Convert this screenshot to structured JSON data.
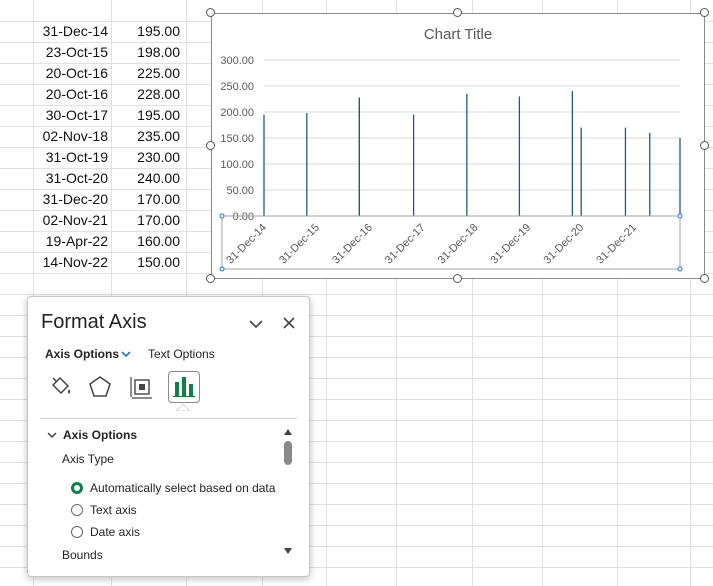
{
  "sheet": {
    "rows": [
      {
        "date": "31-Dec-14",
        "value": "195.00"
      },
      {
        "date": "23-Oct-15",
        "value": "198.00"
      },
      {
        "date": "20-Oct-16",
        "value": "225.00"
      },
      {
        "date": "20-Oct-16",
        "value": "228.00"
      },
      {
        "date": "30-Oct-17",
        "value": "195.00"
      },
      {
        "date": "02-Nov-18",
        "value": "235.00"
      },
      {
        "date": "31-Oct-19",
        "value": "230.00"
      },
      {
        "date": "31-Oct-20",
        "value": "240.00"
      },
      {
        "date": "31-Dec-20",
        "value": "170.00"
      },
      {
        "date": "02-Nov-21",
        "value": "170.00"
      },
      {
        "date": "19-Apr-22",
        "value": "160.00"
      },
      {
        "date": "14-Nov-22",
        "value": "150.00"
      }
    ]
  },
  "chart_data": {
    "type": "bar",
    "title": "Chart Title",
    "x_axis_type": "date",
    "x_range": [
      "2014-12-31",
      "2022-11-14"
    ],
    "ylim": [
      0,
      300
    ],
    "y_ticks": [
      "0.00",
      "50.00",
      "100.00",
      "150.00",
      "200.00",
      "250.00",
      "300.00"
    ],
    "x_ticks": [
      {
        "label": "31-Dec-14",
        "date": "2014-12-31"
      },
      {
        "label": "31-Dec-15",
        "date": "2015-12-31"
      },
      {
        "label": "31-Dec-16",
        "date": "2016-12-31"
      },
      {
        "label": "31-Dec-17",
        "date": "2017-12-31"
      },
      {
        "label": "31-Dec-18",
        "date": "2018-12-31"
      },
      {
        "label": "31-Dec-19",
        "date": "2019-12-31"
      },
      {
        "label": "31-Dec-20",
        "date": "2020-12-31"
      },
      {
        "label": "31-Dec-21",
        "date": "2021-12-31"
      }
    ],
    "points": [
      {
        "x": "2014-12-31",
        "y": 195
      },
      {
        "x": "2015-10-23",
        "y": 198
      },
      {
        "x": "2016-10-20",
        "y": 225
      },
      {
        "x": "2016-10-20",
        "y": 228
      },
      {
        "x": "2017-10-30",
        "y": 195
      },
      {
        "x": "2018-11-02",
        "y": 235
      },
      {
        "x": "2019-10-31",
        "y": 230
      },
      {
        "x": "2020-10-31",
        "y": 240
      },
      {
        "x": "2020-12-31",
        "y": 170
      },
      {
        "x": "2021-11-02",
        "y": 170
      },
      {
        "x": "2022-04-19",
        "y": 160
      },
      {
        "x": "2022-11-14",
        "y": 150
      }
    ],
    "grid": true,
    "colors": {
      "bar": "#1f5c7a",
      "grid": "#d9d9d9",
      "text": "#595959",
      "title": "#595959"
    }
  },
  "pane": {
    "title": "Format Axis",
    "tabs": {
      "axis_options": "Axis Options",
      "text_options": "Text Options"
    },
    "section_title": "Axis Options",
    "axis_type_label": "Axis Type",
    "radios": [
      {
        "label": "Automatically select based on data",
        "selected": true
      },
      {
        "label": "Text axis",
        "selected": false
      },
      {
        "label": "Date axis",
        "selected": false
      }
    ],
    "bounds_label": "Bounds",
    "icons": [
      "fill-line-icon",
      "effects-icon",
      "size-properties-icon",
      "axis-options-bar-icon"
    ],
    "accent": "#127f4a"
  }
}
